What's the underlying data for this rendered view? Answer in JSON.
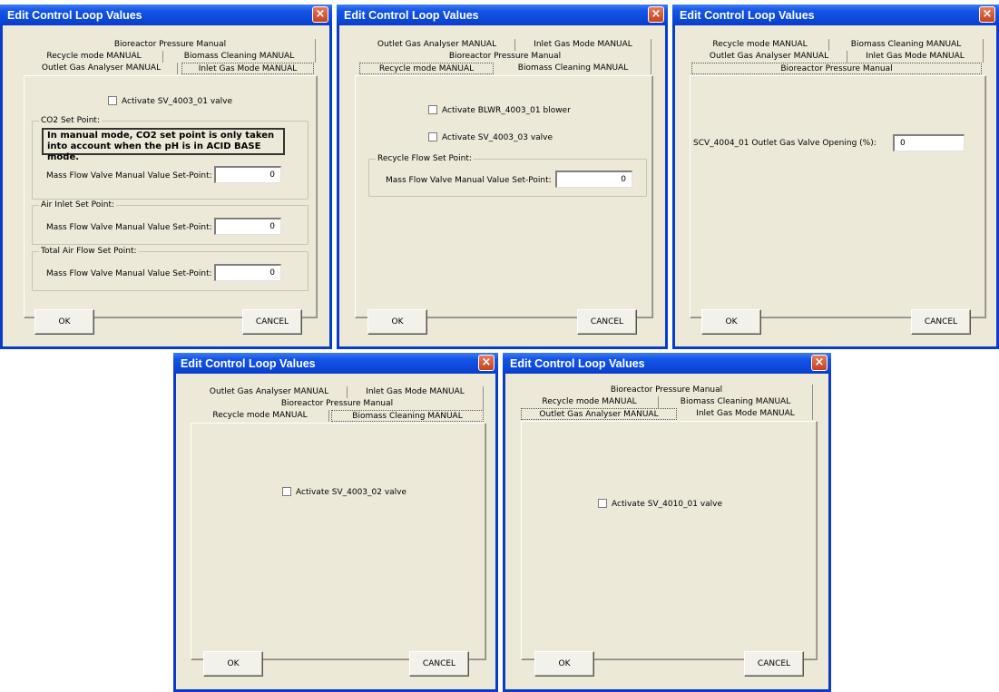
{
  "window_title": "Edit Control Loop Values",
  "close_glyph": "×",
  "tabs": {
    "bioreactor_pressure": "Bioreactor Pressure Manual",
    "recycle_mode": "Recycle mode MANUAL",
    "biomass_cleaning": "Biomass Cleaning MANUAL",
    "outlet_gas_analyser": "Outlet Gas Analyser MANUAL",
    "inlet_gas_mode": "Inlet Gas Mode MANUAL"
  },
  "buttons": {
    "ok": "OK",
    "cancel": "CANCEL"
  },
  "dialog_inlet_gas": {
    "selected_tab": "Inlet Gas Mode MANUAL",
    "checkbox_label": "Activate SV_4003_01 valve",
    "co2_group": "CO2 Set Point:",
    "co2_note": "In manual mode, CO2 set point  is only taken into account  when the pH is in ACID BASE mode.",
    "co2_field_label": "Mass Flow Valve Manual Value Set-Point:",
    "co2_value": "0",
    "air_group": "Air Inlet Set Point:",
    "air_field_label": "Mass Flow Valve Manual Value Set-Point:",
    "air_value": "0",
    "total_group": "Total Air Flow Set Point:",
    "total_field_label": "Mass Flow Valve Manual Value Set-Point:",
    "total_value": "0"
  },
  "dialog_recycle": {
    "selected_tab": "Recycle mode MANUAL",
    "blower_label": "Activate BLWR_4003_01 blower",
    "valve_label": "Activate SV_4003_03 valve",
    "group": "Recycle Flow Set Point:",
    "field_label": "Mass Flow Valve Manual Value Set-Point:",
    "value": "0"
  },
  "dialog_pressure": {
    "selected_tab": "Bioreactor Pressure Manual",
    "field_label": "SCV_4004_01 Outlet Gas Valve Opening (%):",
    "value": "0"
  },
  "dialog_biomass": {
    "selected_tab": "Biomass Cleaning MANUAL",
    "checkbox_label": "Activate SV_4003_02 valve"
  },
  "dialog_outlet": {
    "selected_tab": "Outlet Gas Analyser MANUAL",
    "checkbox_label": "Activate SV_4010_01 valve"
  }
}
